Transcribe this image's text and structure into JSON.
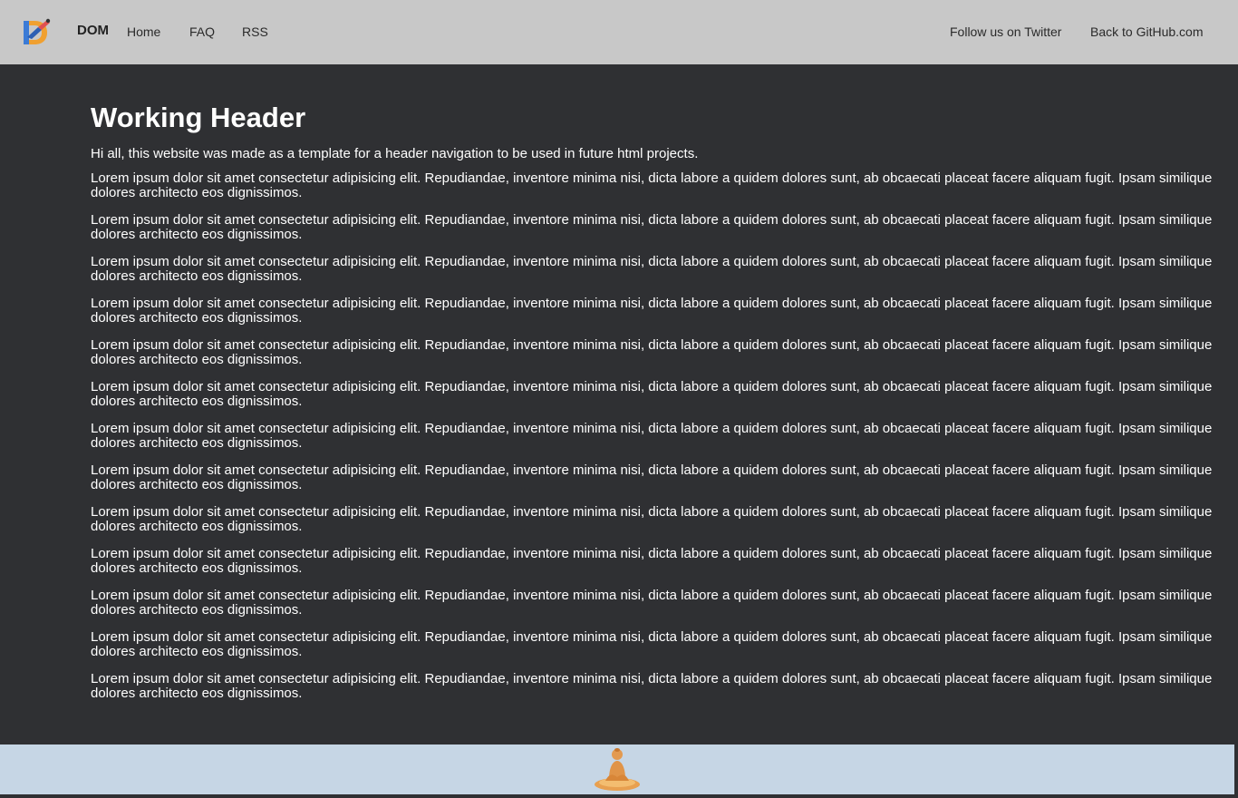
{
  "navbar": {
    "brand": "DOM",
    "links_left": [
      "Home",
      "FAQ",
      "RSS"
    ],
    "links_right": [
      "Follow us on Twitter",
      "Back to GitHub.com"
    ]
  },
  "main": {
    "title": "Working Header",
    "intro": "Hi all, this website was made as a template for a header navigation to be used in future html projects.",
    "paragraphs": [
      "Lorem ipsum dolor sit amet consectetur adipisicing elit. Repudiandae, inventore minima nisi, dicta labore a quidem dolores sunt, ab obcaecati placeat facere aliquam fugit. Ipsam similique dolores architecto eos dignissimos.",
      "Lorem ipsum dolor sit amet consectetur adipisicing elit. Repudiandae, inventore minima nisi, dicta labore a quidem dolores sunt, ab obcaecati placeat facere aliquam fugit. Ipsam similique dolores architecto eos dignissimos.",
      "Lorem ipsum dolor sit amet consectetur adipisicing elit. Repudiandae, inventore minima nisi, dicta labore a quidem dolores sunt, ab obcaecati placeat facere aliquam fugit. Ipsam similique dolores architecto eos dignissimos.",
      "Lorem ipsum dolor sit amet consectetur adipisicing elit. Repudiandae, inventore minima nisi, dicta labore a quidem dolores sunt, ab obcaecati placeat facere aliquam fugit. Ipsam similique dolores architecto eos dignissimos.",
      "Lorem ipsum dolor sit amet consectetur adipisicing elit. Repudiandae, inventore minima nisi, dicta labore a quidem dolores sunt, ab obcaecati placeat facere aliquam fugit. Ipsam similique dolores architecto eos dignissimos.",
      "Lorem ipsum dolor sit amet consectetur adipisicing elit. Repudiandae, inventore minima nisi, dicta labore a quidem dolores sunt, ab obcaecati placeat facere aliquam fugit. Ipsam similique dolores architecto eos dignissimos.",
      "Lorem ipsum dolor sit amet consectetur adipisicing elit. Repudiandae, inventore minima nisi, dicta labore a quidem dolores sunt, ab obcaecati placeat facere aliquam fugit. Ipsam similique dolores architecto eos dignissimos.",
      "Lorem ipsum dolor sit amet consectetur adipisicing elit. Repudiandae, inventore minima nisi, dicta labore a quidem dolores sunt, ab obcaecati placeat facere aliquam fugit. Ipsam similique dolores architecto eos dignissimos.",
      "Lorem ipsum dolor sit amet consectetur adipisicing elit. Repudiandae, inventore minima nisi, dicta labore a quidem dolores sunt, ab obcaecati placeat facere aliquam fugit. Ipsam similique dolores architecto eos dignissimos.",
      "Lorem ipsum dolor sit amet consectetur adipisicing elit. Repudiandae, inventore minima nisi, dicta labore a quidem dolores sunt, ab obcaecati placeat facere aliquam fugit. Ipsam similique dolores architecto eos dignissimos.",
      "Lorem ipsum dolor sit amet consectetur adipisicing elit. Repudiandae, inventore minima nisi, dicta labore a quidem dolores sunt, ab obcaecati placeat facere aliquam fugit. Ipsam similique dolores architecto eos dignissimos.",
      "Lorem ipsum dolor sit amet consectetur adipisicing elit. Repudiandae, inventore minima nisi, dicta labore a quidem dolores sunt, ab obcaecati placeat facere aliquam fugit. Ipsam similique dolores architecto eos dignissimos.",
      "Lorem ipsum dolor sit amet consectetur adipisicing elit. Repudiandae, inventore minima nisi, dicta labore a quidem dolores sunt, ab obcaecati placeat facere aliquam fugit. Ipsam similique dolores architecto eos dignissimos."
    ]
  },
  "icons": {
    "logo": "dom-logo-icon",
    "footer_image": "meditation-figure-icon"
  },
  "colors": {
    "navbar_bg": "#c8c8c8",
    "page_bg": "#2f3033",
    "footer_bg": "#c6d6e5",
    "text": "#ffffff"
  }
}
